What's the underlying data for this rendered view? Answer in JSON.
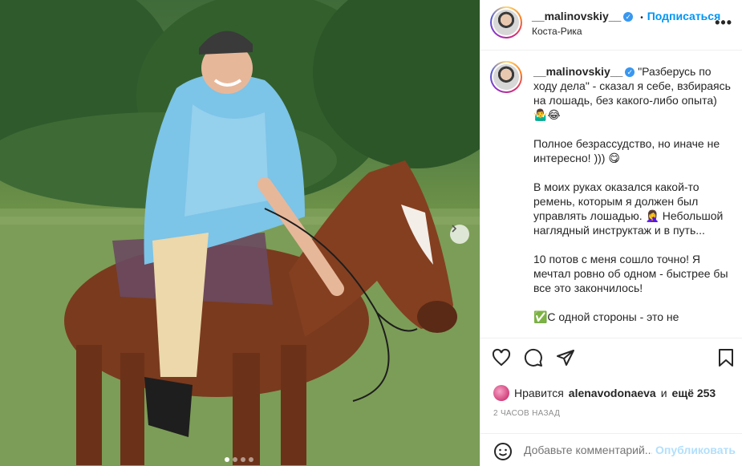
{
  "post": {
    "username": "__malinovskiy__",
    "follow_label": "Подписаться",
    "location": "Коста-Рика",
    "more_label": "•••",
    "verified_mark": "✓",
    "caption": "\"Разберусь по ходу дела\" - сказал я себе, взбираясь на лошадь, без какого-либо опыта) 🤷‍♂️😂\n\nПолное безрассудство, но иначе не интересно! ))) 😋\n\nВ моих руках оказался какой-то ремень, которым я должен был управлять лошадью. 🤦‍♀️ Небольшой наглядный инструктаж и в путь...\n\n10 потов с меня сошло точно! Я мечтал ровно об одном - быстрее бы все это закончилось!\n\n✅С одной стороны - это не",
    "likes_prefix": "Нравится",
    "liked_by": "alenavodonaeva",
    "likes_and": "и",
    "likes_more": "ещё 253",
    "timestamp": "2 ЧАСОВ НАЗАД",
    "comment_placeholder": "Добавьте комментарий...",
    "post_label": "Опубликовать"
  },
  "carousel": {
    "total": 4,
    "active": 1
  }
}
